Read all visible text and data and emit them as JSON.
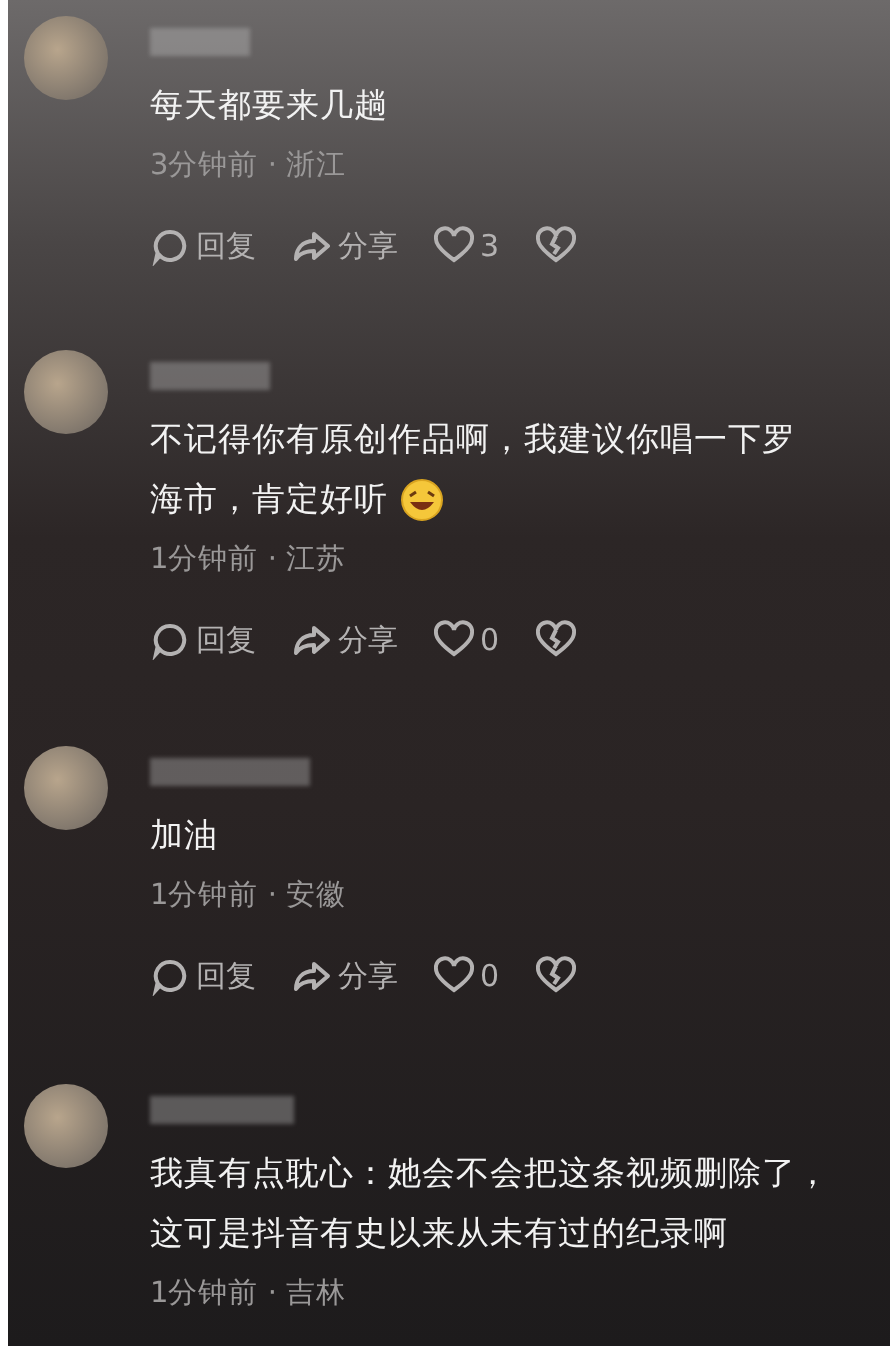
{
  "comments": [
    {
      "lines": [
        "每天都要来几趟"
      ],
      "meta": "3分钟前 · 浙江",
      "actions": {
        "reply": "回复",
        "share": "分享",
        "likes": "3"
      }
    },
    {
      "lines": [
        "不记得你有原创作品啊，我建议你唱一下罗",
        "海市，肯定好听"
      ],
      "emoji": true,
      "meta": "1分钟前 · 江苏",
      "actions": {
        "reply": "回复",
        "share": "分享",
        "likes": "0"
      }
    },
    {
      "lines": [
        "加油"
      ],
      "meta": "1分钟前 · 安徽",
      "actions": {
        "reply": "回复",
        "share": "分享",
        "likes": "0"
      }
    },
    {
      "lines": [
        "我真有点耽心：她会不会把这条视频删除了，",
        "这可是抖音有史以来从未有过的纪录啊"
      ],
      "meta": "1分钟前 · 吉林"
    }
  ]
}
